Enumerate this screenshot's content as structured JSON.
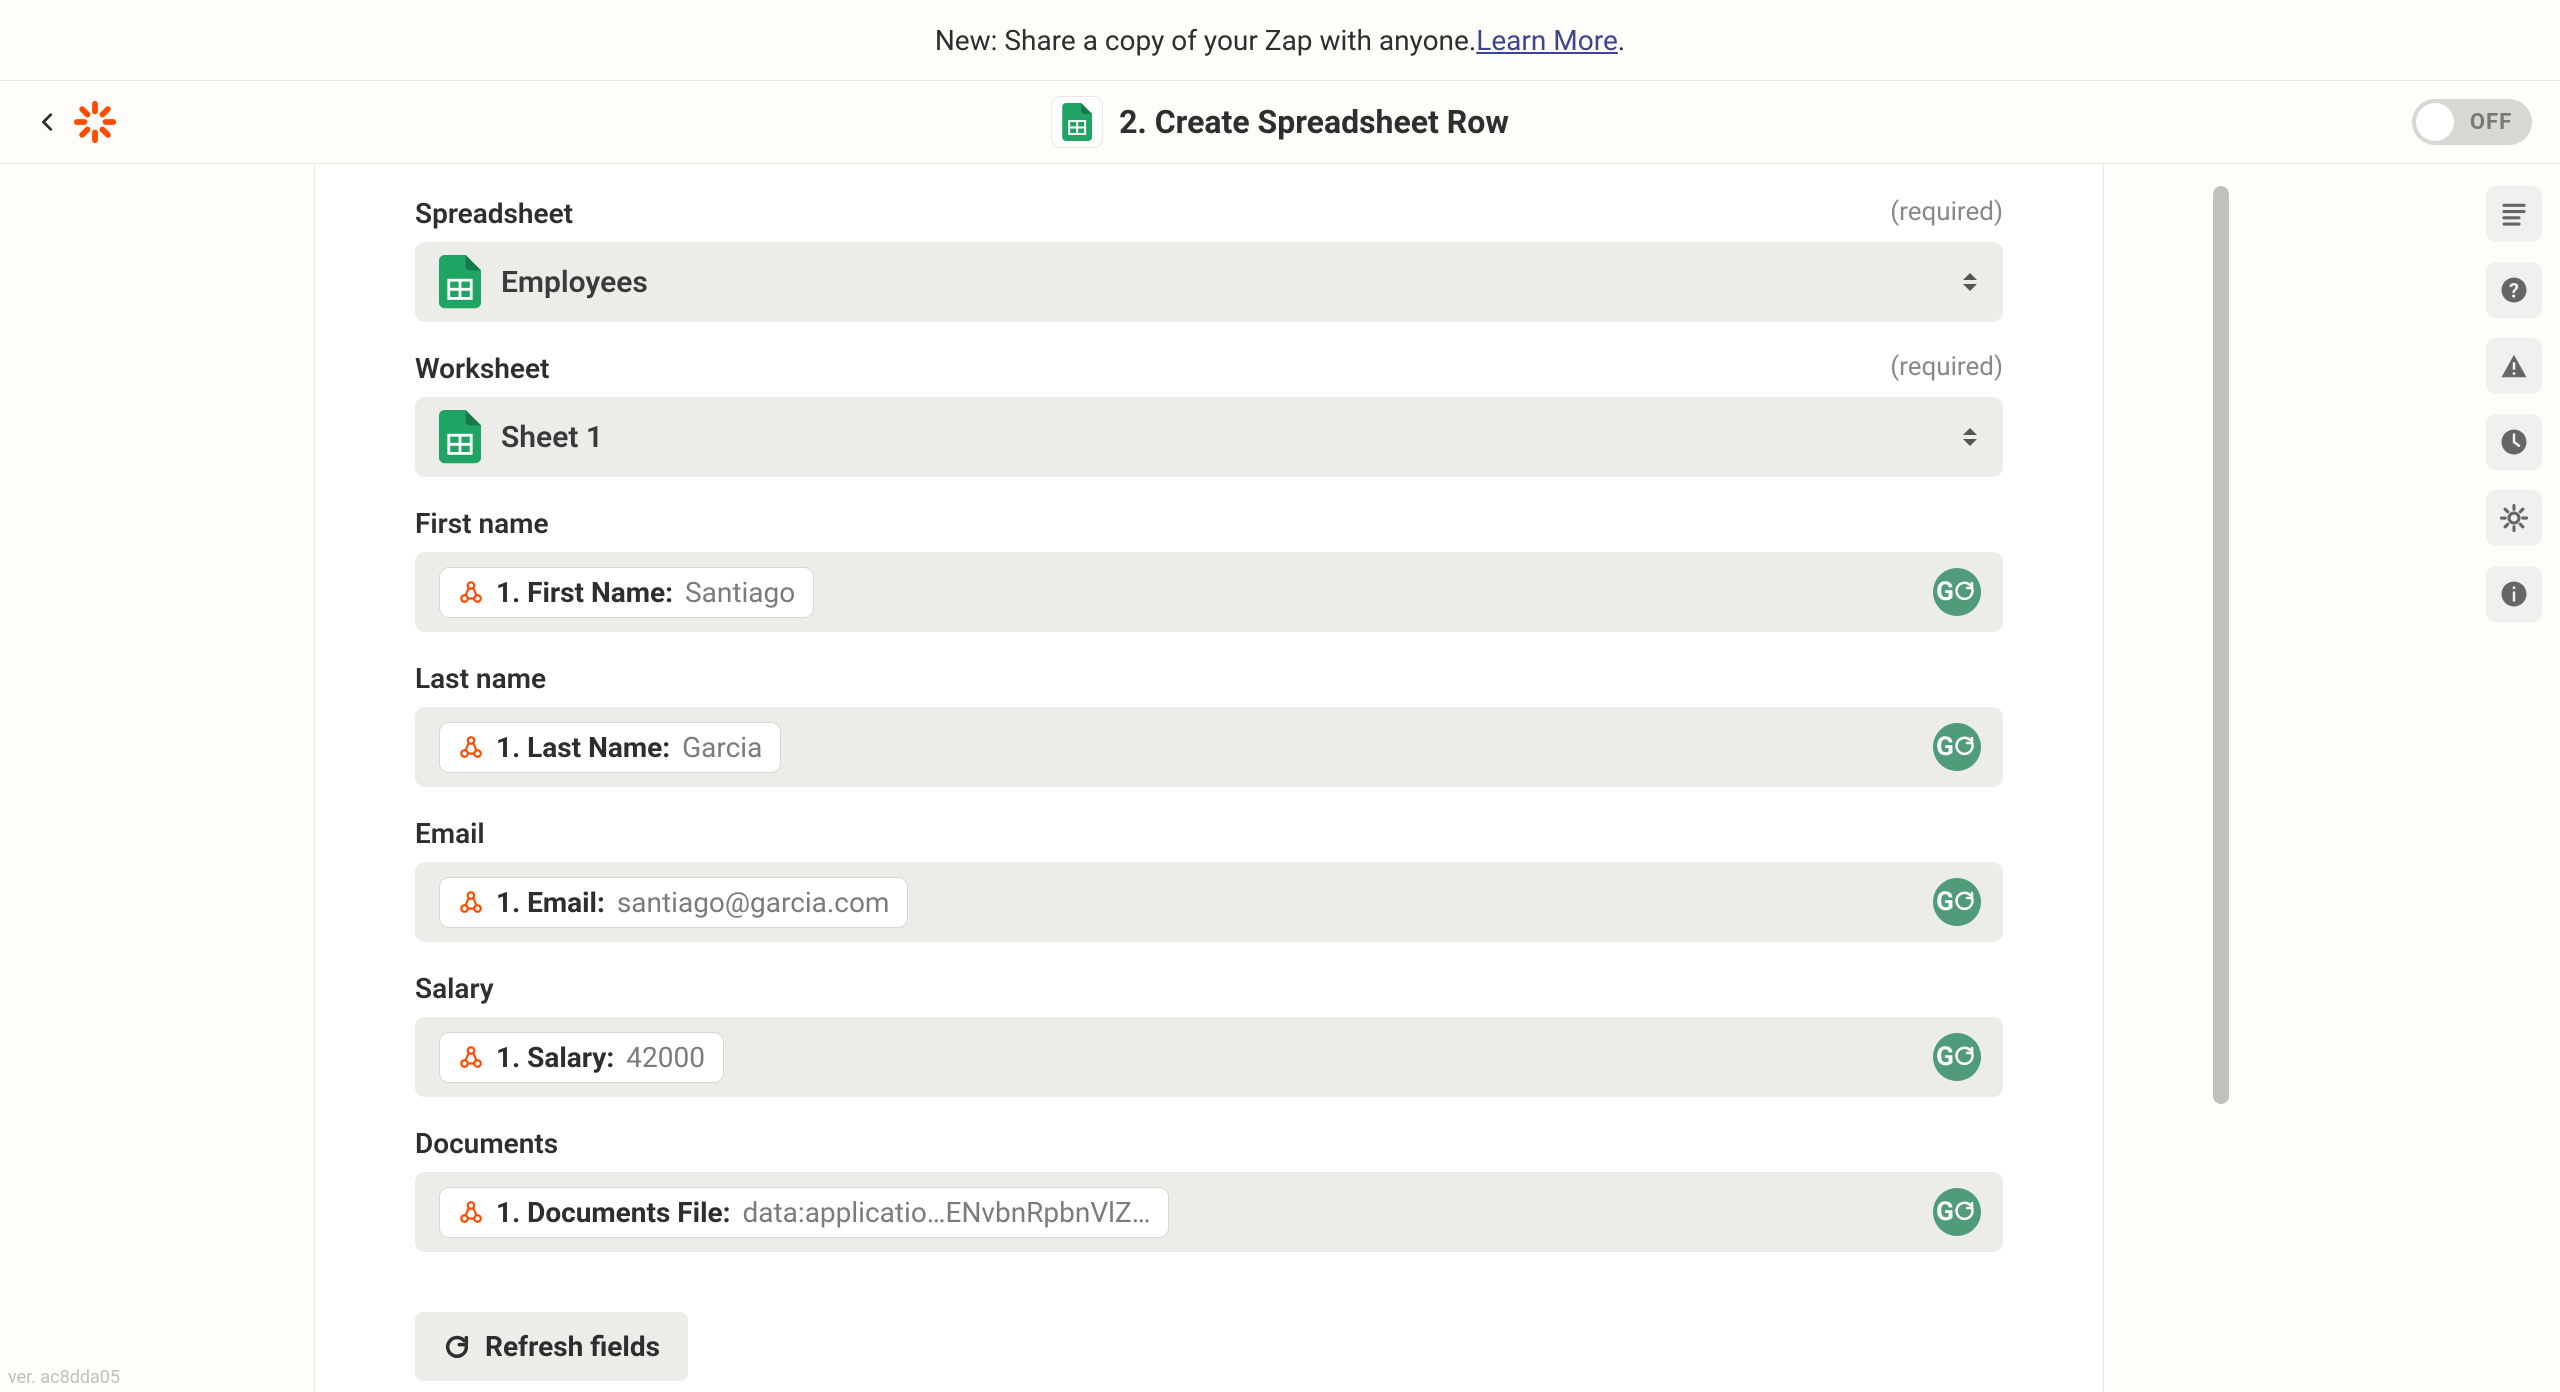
{
  "banner": {
    "text": "New: Share a copy of your Zap with anyone. ",
    "link_text": "Learn More",
    "suffix": "."
  },
  "header": {
    "title": "2. Create Spreadsheet Row",
    "toggle_label": "OFF"
  },
  "fields": {
    "spreadsheet": {
      "label": "Spreadsheet",
      "required_text": "(required)",
      "value": "Employees"
    },
    "worksheet": {
      "label": "Worksheet",
      "required_text": "(required)",
      "value": "Sheet 1"
    },
    "first_name": {
      "label": "First name",
      "pill_key": "1. First Name: ",
      "pill_val": "Santiago"
    },
    "last_name": {
      "label": "Last name",
      "pill_key": "1. Last Name: ",
      "pill_val": "Garcia"
    },
    "email": {
      "label": "Email",
      "pill_key": "1. Email: ",
      "pill_val": "santiago@garcia.com"
    },
    "salary": {
      "label": "Salary",
      "pill_key": "1. Salary: ",
      "pill_val": "42000"
    },
    "documents": {
      "label": "Documents",
      "pill_key": "1. Documents File: ",
      "pill_val": "data:applicatio…ENvbnRpbnVlZ…"
    }
  },
  "refresh_label": "Refresh fields",
  "version": "ver. ac8dda05"
}
